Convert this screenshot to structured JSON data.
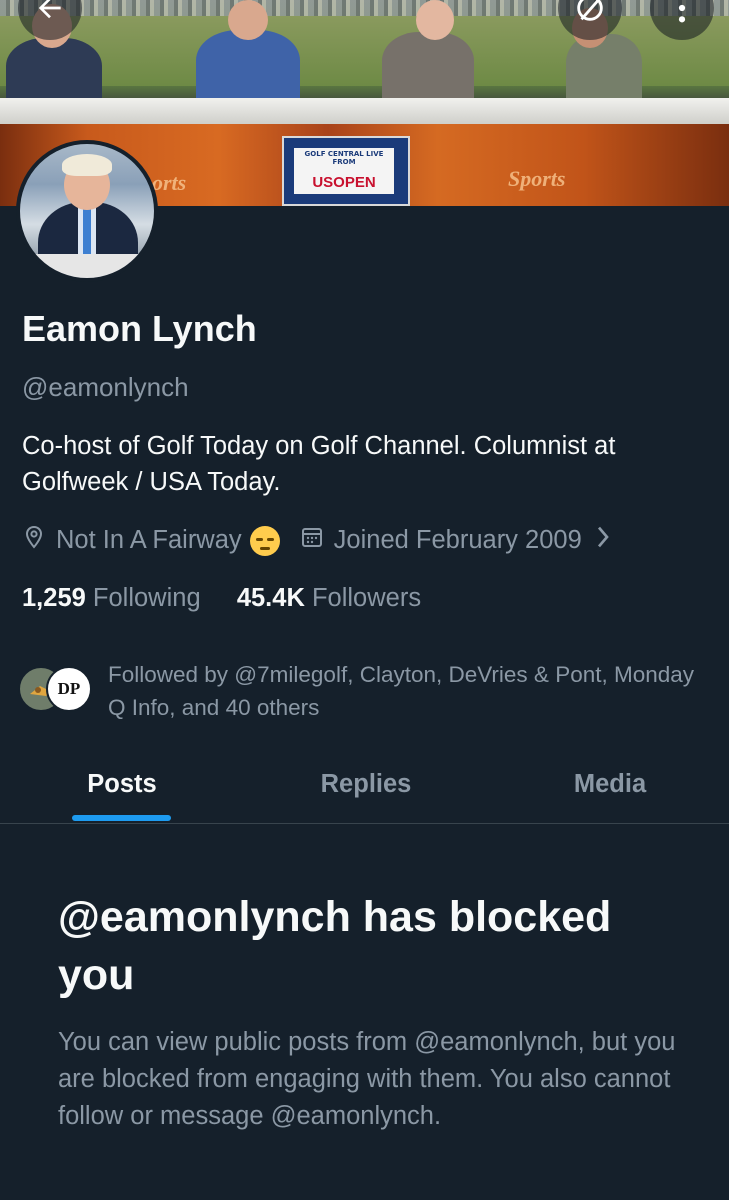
{
  "banner": {
    "desk_card_small": "GOLF CENTRAL LIVE FROM",
    "desk_card_big": "USOPEN",
    "desk_logo": "Sports",
    "desk_logo_partial": "orts"
  },
  "top_bar": {
    "back_icon": "arrow-left-icon",
    "grok_icon": "slash-circle-icon",
    "more_icon": "more-vertical-icon"
  },
  "profile": {
    "name": "Eamon Lynch",
    "handle": "@eamonlynch",
    "bio": "Co-host of Golf Today on Golf Channel. Columnist at Golfweek / USA Today.",
    "location": "Not In A Fairway",
    "joined": "Joined February 2009"
  },
  "stats": {
    "following_count": "1,259",
    "following_label": "Following",
    "followers_count": "45.4K",
    "followers_label": "Followers"
  },
  "followed_by": {
    "text": "Followed by @7milegolf, Clayton, DeVries & Pont, Monday Q Info, and 40 others",
    "mini_avatar_text": "DP"
  },
  "tabs": [
    "Posts",
    "Replies",
    "Media"
  ],
  "blocked": {
    "title": "@eamonlynch has blocked you",
    "body": "You can view public posts from @eamonlynch, but you are blocked from engaging with them. You also cannot follow or message @eamonlynch."
  },
  "colors": {
    "background": "#15202b",
    "accent": "#1d9bf0",
    "secondary_text": "#8b98a5"
  }
}
